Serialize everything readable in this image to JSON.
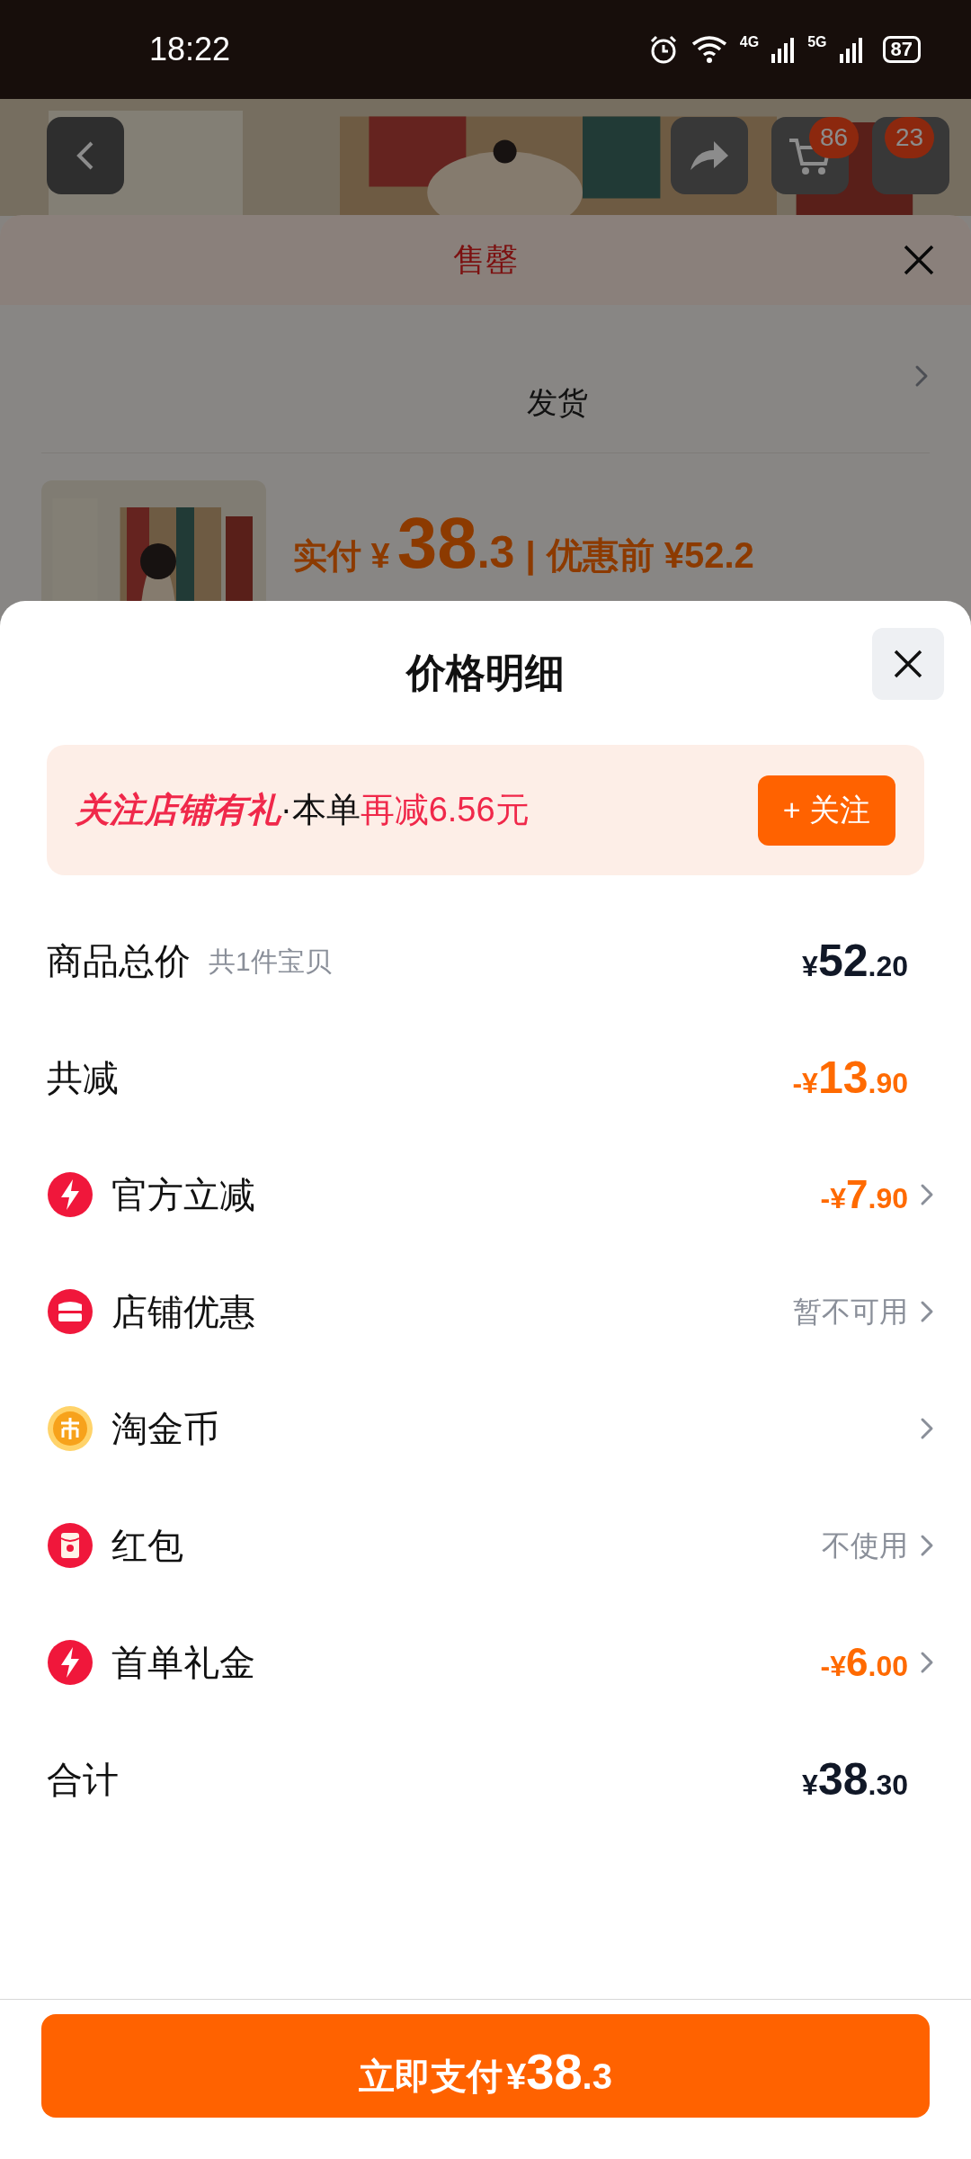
{
  "status_bar": {
    "time": "18:22",
    "network_1": "4G",
    "network_2": "5G",
    "battery": "87"
  },
  "background_page": {
    "cart_badge": "86",
    "message_badge": "23",
    "sheet_title": "售罄",
    "shipping_note": "发货",
    "paid_label": "实付 ¥",
    "paid_main": "38",
    "paid_fraction": ".3",
    "separator": "|",
    "before_label": "优惠前 ¥52.2"
  },
  "sheet": {
    "title": "价格明细",
    "banner": {
      "parts": [
        {
          "kind": "highlight",
          "text": "关注店铺有礼"
        },
        {
          "kind": "plain",
          "text": "·本单"
        },
        {
          "kind": "accent",
          "text": "再减6.56元"
        }
      ],
      "button": "+ 关注"
    },
    "rows": [
      {
        "kind": "plain",
        "label": "商品总价",
        "note": "共1件宝贝",
        "value": {
          "kind": "price",
          "prefix": "¥",
          "main": "52",
          "fraction": ".20"
        },
        "arrow": false
      },
      {
        "kind": "plain",
        "label": "共减",
        "value": {
          "kind": "discount",
          "prefix": "-¥",
          "main": "13",
          "fraction": ".90"
        },
        "arrow": false
      },
      {
        "kind": "bolt",
        "label": "官方立减",
        "value": {
          "kind": "small",
          "prefix": "-¥",
          "main": "7",
          "fraction": ".90"
        },
        "arrow": true
      },
      {
        "kind": "shop",
        "label": "店铺优惠",
        "value": {
          "kind": "note",
          "text": "暂不可用"
        },
        "arrow": true
      },
      {
        "kind": "coin",
        "label": "淘金币",
        "arrow": true
      },
      {
        "kind": "packet",
        "label": "红包",
        "value": {
          "kind": "note",
          "text": "不使用"
        },
        "arrow": true
      },
      {
        "kind": "bolt",
        "label": "首单礼金",
        "value": {
          "kind": "small",
          "prefix": "-¥",
          "main": "6",
          "fraction": ".00"
        },
        "arrow": true
      },
      {
        "kind": "plain",
        "label": "合计",
        "value": {
          "kind": "price",
          "prefix": "¥",
          "main": "38",
          "fraction": ".30"
        },
        "arrow": false
      }
    ],
    "pay_button": {
      "label": "立即支付",
      "prefix": "¥",
      "main": "38",
      "fraction": ".3"
    }
  }
}
